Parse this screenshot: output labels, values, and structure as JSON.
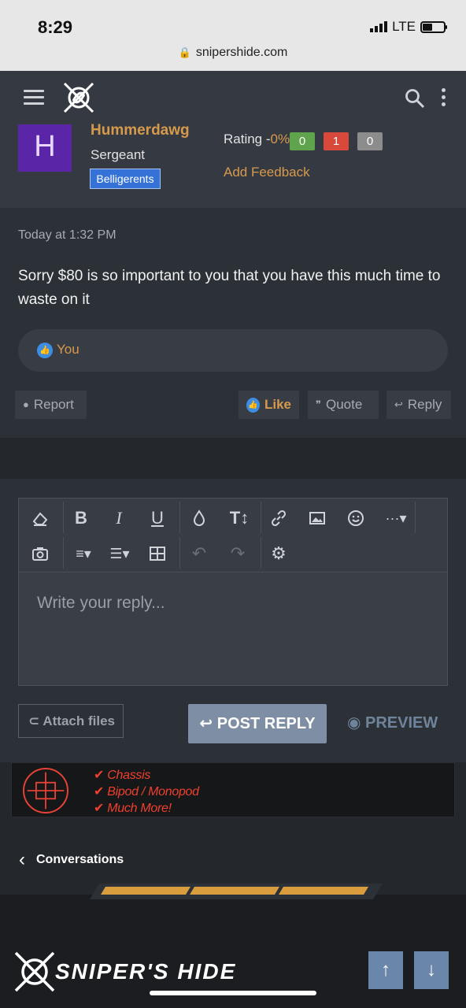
{
  "status_bar": {
    "time": "8:29",
    "network": "LTE",
    "url": "snipershide.com"
  },
  "nav": {
    "menu_icon": "hamburger-icon",
    "logo_icon": "snipers-hide-logo",
    "search_icon": "search-icon",
    "more_icon": "vertical-dots-icon"
  },
  "user": {
    "avatar_letter": "H",
    "name": "Hummerdawg",
    "rank": "Sergeant",
    "badge": "Belligerents",
    "rating_label": "Rating -",
    "rating_pct": "0%",
    "rating_positive": "0",
    "rating_negative": "1",
    "rating_neutral": "0",
    "add_feedback": "Add Feedback"
  },
  "post": {
    "time": "Today at 1:32 PM",
    "text": "Sorry $80 is so important to you that you have this much time to waste on it",
    "reaction_label": "You",
    "actions": {
      "report": "Report",
      "like": "Like",
      "quote": "Quote",
      "reply": "Reply"
    }
  },
  "reply": {
    "placeholder": "Write your reply...",
    "attach": "Attach files",
    "post_reply": "POST REPLY",
    "preview": "PREVIEW"
  },
  "banner": {
    "lines": [
      "Chassis",
      "Bipod / Monopod",
      "Much More!"
    ]
  },
  "conversations": {
    "label": "Conversations"
  },
  "footer": {
    "wordmark": "SNIPER'S HIDE"
  },
  "colors": {
    "accent": "#d79a4c",
    "link_blue": "#3d8de3",
    "post_bg": "#2c3037",
    "button_blue": "#7d8ea5"
  }
}
